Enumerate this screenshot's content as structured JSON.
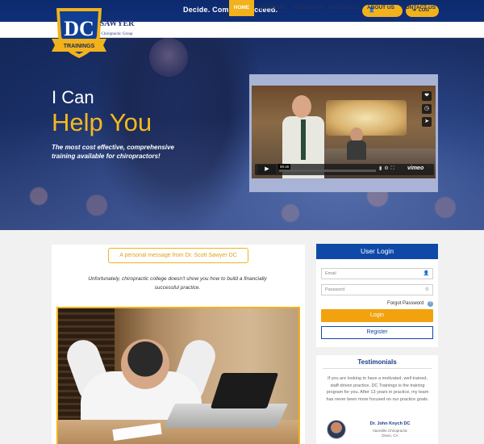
{
  "header": {
    "tagline": "Decide. Commit. Succeed.",
    "register_label": "REGISTER",
    "login_label": "LOG IN"
  },
  "logo": {
    "letters": "DC",
    "ribbon": "TRAININGS"
  },
  "nav": {
    "items": [
      {
        "label": "HOME",
        "active": true
      },
      {
        "label": "Seminars"
      },
      {
        "label": "Webinars"
      },
      {
        "label": "Materials"
      },
      {
        "label": "About Us"
      },
      {
        "label": "Contact Us"
      }
    ]
  },
  "hero": {
    "line1": "I Can",
    "line2": "Help You",
    "subtitle": "The most cost effective, comprehensive training available for chiropractors!"
  },
  "video": {
    "sign_title": "SAWYER",
    "sign_subtitle": "Chiropractic Group",
    "time": "00:40",
    "brand": "vimeo",
    "side_icons": [
      "heart-icon",
      "clock-icon",
      "send-icon"
    ]
  },
  "message": {
    "badge": "A personal message from Dr. Scott Sawyer DC",
    "text": "Unfortunately, chiropractic college doesn't show you how to build a financially successful practice."
  },
  "login": {
    "title": "User Login",
    "email_placeholder": "Email",
    "password_placeholder": "Password",
    "forgot": "Forgot Password",
    "login_button": "Login",
    "register_button": "Register"
  },
  "testimonials": {
    "title": "Testimonials",
    "quote": "If you are looking to have a motivated, well trained, staff-driven practice, DC Trainings is the training program for you. After 13 years in practice, my team has never been more focused on our practice goals.",
    "name": "Dr. John Knych DC",
    "org": "Vazeville Chiropractic",
    "location": "Dixon, CA"
  },
  "colors": {
    "navy": "#0d2a6e",
    "gold": "#f2b21c",
    "blue": "#0f49a8"
  }
}
